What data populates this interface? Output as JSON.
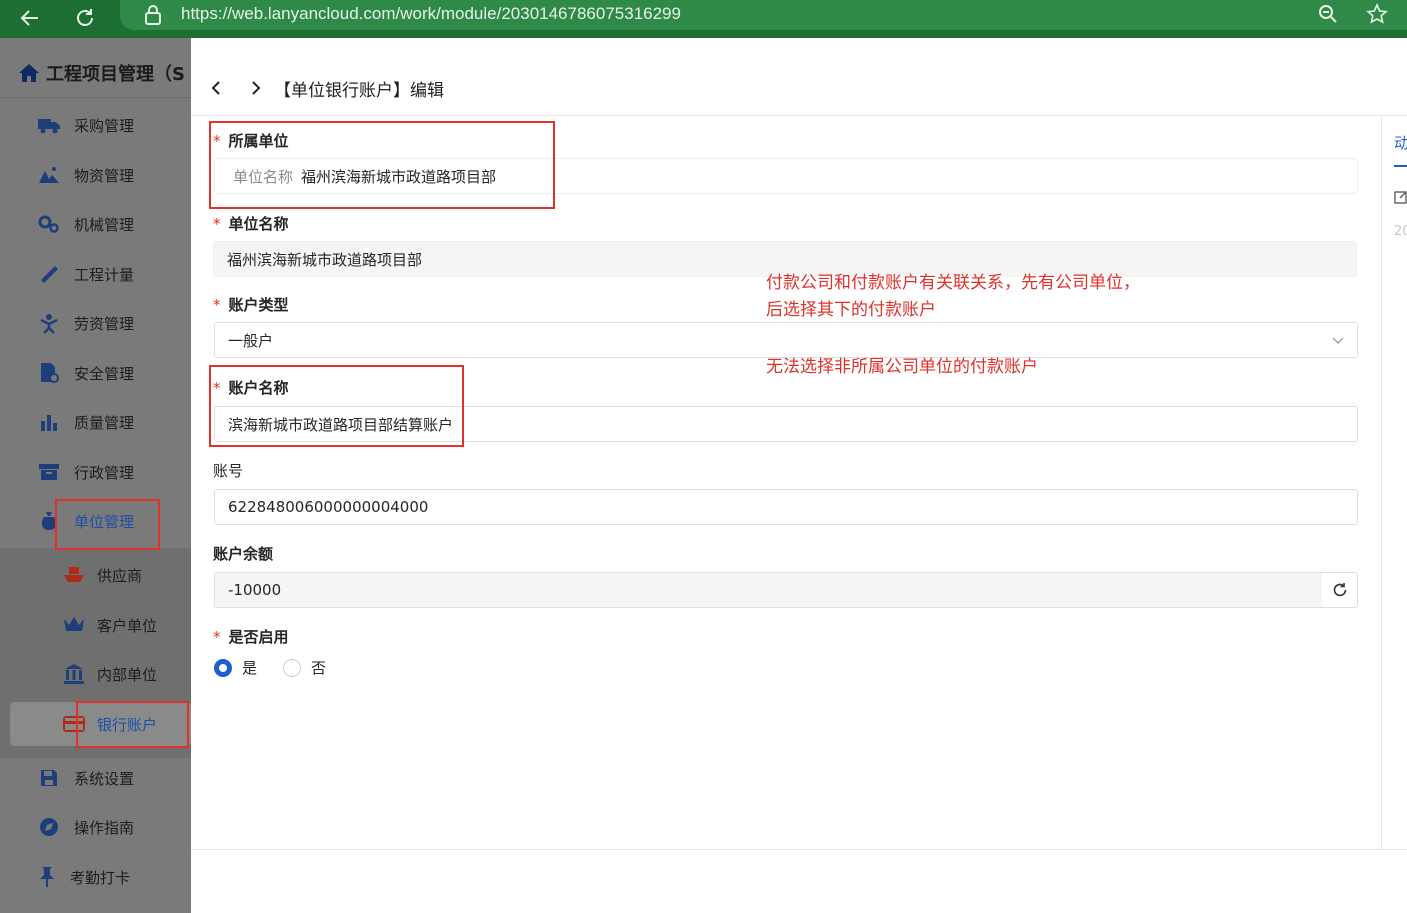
{
  "browser": {
    "url": "https://web.lanyancloud.com/work/module/2030146786075316299"
  },
  "sidebar": {
    "app_title": "工程项目管理（S",
    "items": [
      {
        "label": "采购管理",
        "icon": "truck-icon"
      },
      {
        "label": "物资管理",
        "icon": "boxes-icon"
      },
      {
        "label": "机械管理",
        "icon": "gears-icon"
      },
      {
        "label": "工程计量",
        "icon": "ruler-icon"
      },
      {
        "label": "劳资管理",
        "icon": "worker-icon"
      },
      {
        "label": "安全管理",
        "icon": "file-shield-icon"
      },
      {
        "label": "质量管理",
        "icon": "bar-chart-icon"
      },
      {
        "label": "行政管理",
        "icon": "archive-icon"
      },
      {
        "label": "单位管理",
        "icon": "money-bag-icon"
      }
    ],
    "sub_items": [
      {
        "label": "供应商",
        "icon": "ship-icon"
      },
      {
        "label": "客户单位",
        "icon": "crown-icon"
      },
      {
        "label": "内部单位",
        "icon": "building-icon"
      },
      {
        "label": "银行账户",
        "icon": "card-icon"
      }
    ],
    "bottom_items": [
      {
        "label": "系统设置",
        "icon": "save-icon"
      },
      {
        "label": "操作指南",
        "icon": "compass-icon"
      },
      {
        "label": "考勤打卡",
        "icon": "pin-icon"
      }
    ]
  },
  "drawer": {
    "title": "【单位银行账户】编辑",
    "fields": {
      "owner_unit_label": "所属单位",
      "owner_unit_prefix": "单位名称",
      "owner_unit_value": "福州滨海新城市政道路项目部",
      "unit_name_label": "单位名称",
      "unit_name_value": "福州滨海新城市政道路项目部",
      "account_type_label": "账户类型",
      "account_type_value": "一般户",
      "account_name_label": "账户名称",
      "account_name_value": "滨海新城市政道路项目部结算账户",
      "account_no_label": "账号",
      "account_no_value": "622848006000000004000",
      "balance_label": "账户余额",
      "balance_value": "-10000",
      "enabled_label": "是否启用",
      "enabled_options": [
        "是",
        "否"
      ],
      "enabled_selected": "是"
    },
    "right_panel": {
      "tab_char": "动",
      "year_char": "20"
    }
  },
  "annotations": {
    "note_line1": "付款公司和付款账户有关联关系，先有公司单位，",
    "note_line2": "后选择其下的付款账户",
    "note_line3": "无法选择非所属公司单位的付款账户"
  },
  "colors": {
    "accent": "#1d5fd1",
    "required": "#e0311d",
    "annotation": "#e0312b",
    "browser": "#1e6f33"
  }
}
